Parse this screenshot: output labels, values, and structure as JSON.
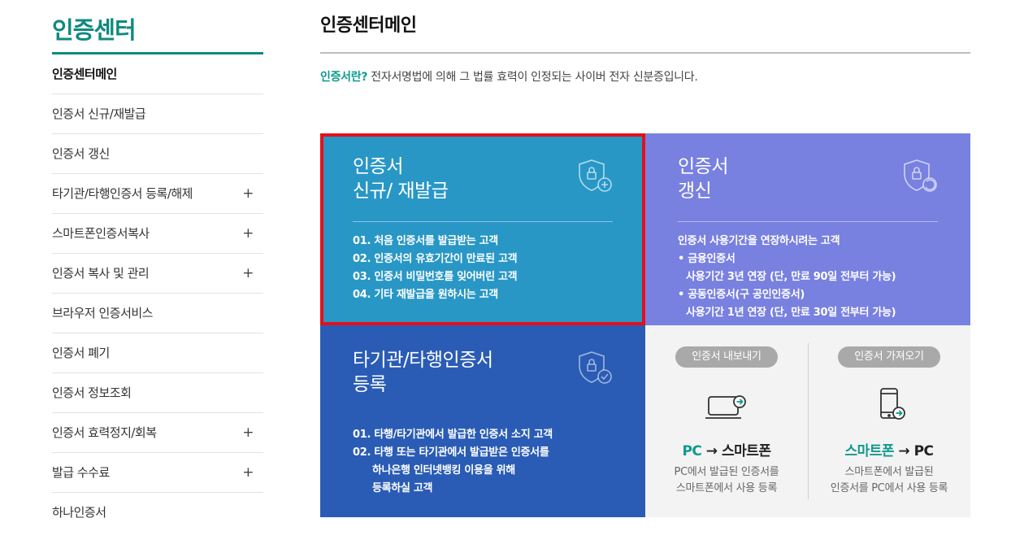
{
  "sidebar": {
    "title": "인증센터",
    "items": [
      {
        "label": "인증센터메인",
        "has_sub": false
      },
      {
        "label": "인증서 신규/재발급",
        "has_sub": false
      },
      {
        "label": "인증서 갱신",
        "has_sub": false
      },
      {
        "label": "타기관/타행인증서 등록/해제",
        "has_sub": true
      },
      {
        "label": "스마트폰인증서복사",
        "has_sub": true
      },
      {
        "label": "인증서 복사 및 관리",
        "has_sub": true
      },
      {
        "label": "브라우저 인증서비스",
        "has_sub": false
      },
      {
        "label": "인증서 폐기",
        "has_sub": false
      },
      {
        "label": "인증서 정보조회",
        "has_sub": false
      },
      {
        "label": "인증서 효력정지/회복",
        "has_sub": true
      },
      {
        "label": "발급 수수료",
        "has_sub": true
      },
      {
        "label": "하나인증서",
        "has_sub": false
      }
    ],
    "expand_symbol": "+"
  },
  "main": {
    "title": "인증센터메인",
    "intro_term": "인증서란?",
    "intro_text": " 전자서명법에 의해 그 법률 효력이 인정되는 사이버 전자 신분증입니다."
  },
  "cards": {
    "issue": {
      "title_line1": "인증서",
      "title_line2": "신규/ 재발급",
      "items": [
        "01. 처음 인증서를 발급받는 고객",
        "02. 인증서의 유효기간이 만료된 고객",
        "03. 인증서 비밀번호를 잊어버린 고객",
        "04. 기타 재발급을 원하시는 고객"
      ],
      "color": "#2897c6"
    },
    "renew": {
      "title_line1": "인증서",
      "title_line2": "갱신",
      "lead": "인증서 사용기간을 연장하시려는 고객",
      "bullet1": "• 금융인증서",
      "bullet1_detail": "사용기간 3년 연장 (단, 만료 90일 전부터 가능)",
      "bullet2": "• 공동인증서(구 공인인증서)",
      "bullet2_detail": "사용기간 1년 연장 (단, 만료 30일 전부터 가능)",
      "color": "#7880e0"
    },
    "register": {
      "title_line1": "타기관/타행인증서",
      "title_line2": "등록",
      "item1": "01. 타행/타기관에서 발급한 인증서 소지 고객",
      "item2": "02. 타행 또는 타기관에서 발급받은 인증서를",
      "item2_cont1": "하나은행 인터넷뱅킹 이용을 위해",
      "item2_cont2": "등록하실 고객",
      "color": "#2a5cb5"
    },
    "copy": {
      "export": {
        "button": "인증서 내보내기",
        "heading_accent": "PC",
        "heading_rest": " → 스마트폰",
        "desc_line1": "PC에서 발급된 인증서를",
        "desc_line2": "스마트폰에서 사용 등록"
      },
      "import": {
        "button": "인증서 가져오기",
        "heading_accent": "스마트폰",
        "heading_rest": " → PC",
        "desc_line1": "스마트폰에서 발급된",
        "desc_line2": "인증서를 PC에서 사용 등록"
      }
    }
  },
  "colors": {
    "brand": "#0f8a80",
    "accent": "#0f9a8e",
    "highlight": "#e3101a"
  }
}
